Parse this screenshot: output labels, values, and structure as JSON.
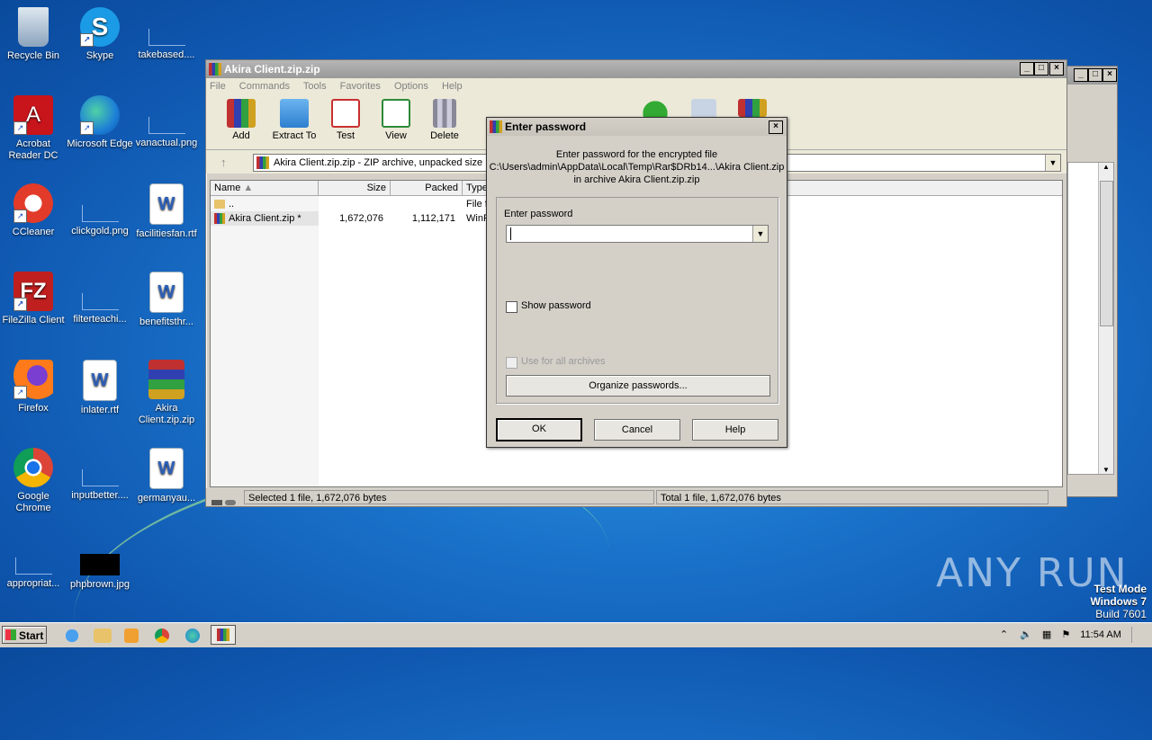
{
  "desktop": {
    "icons": [
      {
        "label": "Recycle Bin"
      },
      {
        "label": "Skype"
      },
      {
        "label": "takebased...."
      },
      {
        "label": "Acrobat Reader DC"
      },
      {
        "label": "Microsoft Edge"
      },
      {
        "label": "vanactual.png"
      },
      {
        "label": "CCleaner"
      },
      {
        "label": "clickgold.png"
      },
      {
        "label": "facilitiesfan.rtf"
      },
      {
        "label": "FileZilla Client"
      },
      {
        "label": "filterteachi..."
      },
      {
        "label": "benefitsthr..."
      },
      {
        "label": "Firefox"
      },
      {
        "label": "inlater.rtf"
      },
      {
        "label": "Akira Client.zip.zip"
      },
      {
        "label": "Google Chrome"
      },
      {
        "label": "inputbetter...."
      },
      {
        "label": "germanyau..."
      },
      {
        "label": "appropriat..."
      },
      {
        "label": "phpbrown.jpg"
      }
    ]
  },
  "winrar": {
    "title": "Akira Client.zip.zip",
    "menu": [
      "File",
      "Commands",
      "Tools",
      "Favorites",
      "Options",
      "Help"
    ],
    "toolbar": [
      "Add",
      "Extract To",
      "Test",
      "View",
      "Delete"
    ],
    "address": "Akira Client.zip.zip - ZIP archive, unpacked size 1",
    "columns": [
      "Name",
      "Size",
      "Packed",
      "Type"
    ],
    "rows": [
      {
        "name": "..",
        "size": "",
        "packed": "",
        "type": "File f"
      },
      {
        "name": "Akira Client.zip *",
        "size": "1,672,076",
        "packed": "1,112,171",
        "type": "WinR"
      }
    ],
    "status_left": "Selected 1 file, 1,672,076 bytes",
    "status_right": "Total 1 file, 1,672,076 bytes"
  },
  "dialog": {
    "title": "Enter password",
    "msg_line1": "Enter password for the encrypted file",
    "msg_line2": "C:\\Users\\admin\\AppData\\Local\\Temp\\Rar$DRb14...\\Akira Client.zip",
    "msg_line3": "in archive Akira Client.zip.zip",
    "pw_label": "Enter password",
    "pw_value": "",
    "show_password": "Show password",
    "use_all": "Use for all archives",
    "organize": "Organize passwords...",
    "ok": "OK",
    "cancel": "Cancel",
    "help": "Help"
  },
  "taskbar": {
    "start": "Start",
    "time": "11:54 AM"
  },
  "watermark": {
    "line1": "Test Mode",
    "line2": "Windows 7",
    "line3": "Build 7601",
    "brand": "ANY RUN"
  }
}
